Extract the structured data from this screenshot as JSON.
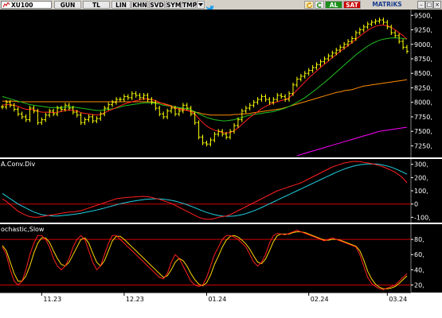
{
  "toolbar": {
    "symbol": "XU100",
    "buttons": [
      "GUN",
      "TL",
      "LIN",
      "KHN",
      "SVD",
      "SYM",
      "TMP"
    ],
    "al": "AL",
    "sat": "SAT",
    "matriks": "MATRiKS",
    "colors": {
      "al": "#1a8f1a",
      "sat": "#cc0000"
    }
  },
  "chart_data": [
    {
      "type": "candlestick",
      "panel": "price",
      "ylim": [
        7050,
        9600
      ],
      "yticks": [
        7250,
        7500,
        7750,
        8000,
        8250,
        8500,
        8750,
        9000,
        9250,
        9500
      ],
      "ytick_labels": [
        "7250,",
        "7500,",
        "7750,",
        "8000,",
        "8250,",
        "8500,",
        "8750,",
        "9000,",
        "9250,",
        "9500,"
      ],
      "grid": true,
      "colors": {
        "bars": "#ffff00",
        "ma_short": "#ff2020",
        "ma_medium": "#20c020",
        "ma_long": "#ff8c00",
        "ma_vlong": "#ff00ff"
      },
      "close": [
        7920,
        8000,
        7950,
        7880,
        7800,
        7750,
        7700,
        7900,
        7850,
        7650,
        7700,
        7780,
        7850,
        7800,
        7900,
        7880,
        7950,
        7900,
        7830,
        7780,
        7650,
        7700,
        7750,
        7680,
        7720,
        7800,
        7900,
        7960,
        8000,
        8050,
        8050,
        8100,
        8080,
        8150,
        8120,
        8080,
        8120,
        8050,
        8000,
        7900,
        7800,
        7750,
        7850,
        7900,
        7800,
        7850,
        7950,
        7900,
        7800,
        7650,
        7400,
        7300,
        7280,
        7350,
        7450,
        7500,
        7450,
        7400,
        7500,
        7600,
        7700,
        7850,
        7900,
        7950,
        8000,
        8050,
        8100,
        8050,
        8000,
        8050,
        8120,
        8100,
        8050,
        8150,
        8300,
        8400,
        8450,
        8500,
        8550,
        8600,
        8650,
        8700,
        8750,
        8800,
        8850,
        8900,
        8950,
        9000,
        9050,
        9100,
        9200,
        9250,
        9300,
        9350,
        9380,
        9400,
        9420,
        9380,
        9300,
        9200,
        9150,
        9050,
        8950,
        8880
      ],
      "ma_short": [
        7950,
        7960,
        7960,
        7950,
        7930,
        7900,
        7880,
        7880,
        7870,
        7850,
        7830,
        7830,
        7830,
        7820,
        7830,
        7840,
        7860,
        7870,
        7860,
        7850,
        7820,
        7810,
        7800,
        7790,
        7780,
        7790,
        7820,
        7850,
        7880,
        7910,
        7940,
        7970,
        7990,
        8010,
        8030,
        8040,
        8060,
        8060,
        8050,
        8030,
        8000,
        7970,
        7950,
        7930,
        7900,
        7880,
        7870,
        7860,
        7840,
        7800,
        7720,
        7650,
        7590,
        7550,
        7520,
        7500,
        7480,
        7470,
        7480,
        7510,
        7560,
        7620,
        7680,
        7740,
        7790,
        7840,
        7890,
        7930,
        7960,
        7990,
        8010,
        8030,
        8050,
        8080,
        8140,
        8210,
        8280,
        8350,
        8420,
        8480,
        8540,
        8600,
        8660,
        8710,
        8770,
        8820,
        8880,
        8930,
        8980,
        9030,
        9090,
        9140,
        9190,
        9240,
        9280,
        9310,
        9330,
        9330,
        9320,
        9290,
        9250,
        9200,
        9150,
        9090
      ],
      "ma_medium": [
        8100,
        8080,
        8060,
        8040,
        8020,
        8000,
        7980,
        7960,
        7950,
        7940,
        7930,
        7920,
        7910,
        7910,
        7910,
        7910,
        7920,
        7920,
        7920,
        7910,
        7900,
        7890,
        7880,
        7870,
        7860,
        7860,
        7870,
        7880,
        7890,
        7900,
        7920,
        7940,
        7950,
        7960,
        7970,
        7980,
        7990,
        7990,
        7990,
        7980,
        7970,
        7950,
        7940,
        7930,
        7920,
        7910,
        7900,
        7890,
        7870,
        7840,
        7800,
        7770,
        7740,
        7720,
        7700,
        7690,
        7680,
        7680,
        7690,
        7700,
        7720,
        7740,
        7760,
        7780,
        7790,
        7800,
        7810,
        7820,
        7830,
        7840,
        7860,
        7880,
        7900,
        7930,
        7960,
        8000,
        8040,
        8080,
        8130,
        8180,
        8230,
        8290,
        8340,
        8400,
        8460,
        8520,
        8580,
        8640,
        8700,
        8760,
        8820,
        8870,
        8920,
        8970,
        9010,
        9040,
        9070,
        9090,
        9100,
        9110,
        9110,
        9110,
        9100,
        9090
      ],
      "ma_long": [
        8020,
        8020,
        8020,
        8020,
        8010,
        8010,
        8010,
        8010,
        8010,
        8010,
        8010,
        8010,
        8010,
        8010,
        8010,
        8010,
        8010,
        8010,
        8010,
        8010,
        8010,
        8010,
        8010,
        8010,
        8010,
        8010,
        8010,
        8010,
        8010,
        8010,
        8010,
        8010,
        8010,
        8010,
        8010,
        8010,
        8010,
        8010,
        8010,
        8000,
        7990,
        7980,
        7960,
        7940,
        7920,
        7900,
        7880,
        7860,
        7850,
        7830,
        7820,
        7800,
        7790,
        7780,
        7780,
        7780,
        7780,
        7780,
        7780,
        7790,
        7790,
        7800,
        7800,
        7810,
        7820,
        7830,
        7840,
        7850,
        7860,
        7870,
        7880,
        7890,
        7910,
        7930,
        7950,
        7970,
        7990,
        8010,
        8030,
        8050,
        8070,
        8090,
        8110,
        8130,
        8150,
        8170,
        8180,
        8200,
        8210,
        8220,
        8240,
        8260,
        8280,
        8290,
        8300,
        8310,
        8320,
        8330,
        8340,
        8350,
        8360,
        8370,
        8380,
        8390
      ],
      "ma_vlong": [
        null,
        null,
        null,
        null,
        null,
        null,
        null,
        null,
        null,
        null,
        null,
        null,
        null,
        null,
        null,
        null,
        null,
        null,
        null,
        null,
        null,
        null,
        null,
        null,
        null,
        null,
        null,
        null,
        null,
        null,
        null,
        null,
        null,
        null,
        null,
        null,
        null,
        null,
        null,
        null,
        null,
        null,
        null,
        null,
        null,
        null,
        null,
        null,
        null,
        null,
        null,
        null,
        null,
        null,
        null,
        null,
        null,
        null,
        null,
        null,
        null,
        null,
        null,
        null,
        null,
        null,
        null,
        null,
        null,
        null,
        null,
        null,
        null,
        null,
        null,
        7080,
        7100,
        7120,
        7140,
        7160,
        7180,
        7200,
        7220,
        7240,
        7260,
        7280,
        7300,
        7320,
        7340,
        7360,
        7380,
        7400,
        7420,
        7440,
        7460,
        7480,
        7500,
        7510,
        7520,
        7530,
        7540,
        7550,
        7560,
        7570
      ]
    },
    {
      "type": "line",
      "panel": "macd",
      "title": "A.Conv.Div",
      "ylim": [
        -140,
        340
      ],
      "yticks": [
        300,
        200,
        100,
        0,
        -100
      ],
      "ytick_labels": [
        "300,",
        "200,",
        "100,",
        "0",
        "-100,"
      ],
      "colors": {
        "macd": "#ff2020",
        "signal": "#20d0e0",
        "zero": "#cc0000"
      },
      "macd": [
        40,
        20,
        -5,
        -30,
        -55,
        -70,
        -85,
        -95,
        -100,
        -100,
        -95,
        -90,
        -85,
        -80,
        -75,
        -70,
        -65,
        -60,
        -60,
        -55,
        -50,
        -40,
        -30,
        -20,
        -10,
        0,
        10,
        20,
        30,
        40,
        45,
        48,
        50,
        52,
        55,
        56,
        58,
        55,
        50,
        42,
        35,
        25,
        15,
        5,
        -10,
        -25,
        -40,
        -55,
        -70,
        -85,
        -100,
        -110,
        -115,
        -115,
        -110,
        -100,
        -95,
        -90,
        -80,
        -65,
        -50,
        -35,
        -20,
        -5,
        10,
        25,
        40,
        55,
        70,
        85,
        100,
        110,
        120,
        130,
        140,
        150,
        160,
        175,
        190,
        205,
        220,
        235,
        250,
        265,
        280,
        290,
        300,
        310,
        315,
        320,
        322,
        320,
        315,
        310,
        305,
        298,
        290,
        280,
        268,
        255,
        240,
        220,
        195,
        160
      ],
      "signal": [
        80,
        60,
        40,
        20,
        0,
        -15,
        -30,
        -45,
        -60,
        -70,
        -80,
        -85,
        -88,
        -90,
        -90,
        -88,
        -85,
        -82,
        -78,
        -74,
        -70,
        -64,
        -58,
        -52,
        -45,
        -38,
        -30,
        -22,
        -14,
        -6,
        2,
        8,
        14,
        20,
        25,
        30,
        34,
        37,
        39,
        40,
        39,
        37,
        33,
        28,
        22,
        14,
        5,
        -5,
        -16,
        -28,
        -40,
        -52,
        -63,
        -72,
        -80,
        -86,
        -90,
        -92,
        -92,
        -90,
        -86,
        -80,
        -72,
        -62,
        -51,
        -39,
        -26,
        -12,
        2,
        16,
        30,
        44,
        58,
        72,
        86,
        100,
        114,
        128,
        142,
        156,
        170,
        184,
        198,
        212,
        226,
        240,
        252,
        264,
        274,
        283,
        290,
        296,
        300,
        302,
        303,
        302,
        299,
        294,
        287,
        278,
        267,
        254,
        240,
        225
      ]
    },
    {
      "type": "line",
      "panel": "stochastic",
      "title": "ochastic,Slow",
      "ylim": [
        10,
        100
      ],
      "yticks": [
        80,
        60,
        40,
        20
      ],
      "ytick_labels": [
        "80,",
        "60,",
        "40,",
        "20,"
      ],
      "levels": [
        80,
        20
      ],
      "colors": {
        "k": "#ff2020",
        "d": "#ffd700",
        "levels": "#cc0000"
      },
      "k": [
        70,
        60,
        40,
        25,
        20,
        25,
        40,
        60,
        75,
        85,
        85,
        80,
        70,
        55,
        45,
        40,
        45,
        55,
        70,
        80,
        85,
        80,
        65,
        50,
        40,
        45,
        60,
        75,
        85,
        85,
        80,
        75,
        70,
        65,
        60,
        55,
        50,
        45,
        40,
        35,
        30,
        28,
        35,
        50,
        60,
        55,
        45,
        35,
        25,
        20,
        18,
        20,
        30,
        45,
        60,
        70,
        80,
        85,
        85,
        83,
        80,
        75,
        70,
        60,
        50,
        45,
        50,
        60,
        75,
        85,
        88,
        87,
        86,
        88,
        90,
        92,
        90,
        88,
        86,
        84,
        82,
        80,
        78,
        80,
        82,
        80,
        78,
        76,
        74,
        72,
        70,
        60,
        45,
        30,
        22,
        18,
        15,
        14,
        16,
        18,
        20,
        25,
        30,
        35
      ],
      "d": [
        72,
        65,
        50,
        35,
        25,
        25,
        32,
        45,
        62,
        75,
        82,
        82,
        76,
        65,
        55,
        47,
        45,
        50,
        60,
        70,
        80,
        82,
        75,
        62,
        50,
        45,
        52,
        65,
        78,
        84,
        84,
        80,
        75,
        70,
        65,
        60,
        55,
        50,
        45,
        40,
        35,
        30,
        32,
        40,
        50,
        55,
        52,
        45,
        35,
        27,
        21,
        19,
        23,
        33,
        47,
        58,
        70,
        79,
        84,
        85,
        83,
        79,
        74,
        67,
        58,
        50,
        48,
        54,
        65,
        77,
        85,
        87,
        87,
        87,
        89,
        90,
        90,
        89,
        87,
        85,
        83,
        81,
        79,
        79,
        80,
        80,
        79,
        77,
        75,
        73,
        71,
        65,
        53,
        38,
        28,
        21,
        17,
        15,
        15,
        16,
        18,
        22,
        27,
        32
      ]
    }
  ],
  "dates": [
    "11.23",
    "12.23",
    "01.24",
    "02.24",
    "03.24"
  ]
}
